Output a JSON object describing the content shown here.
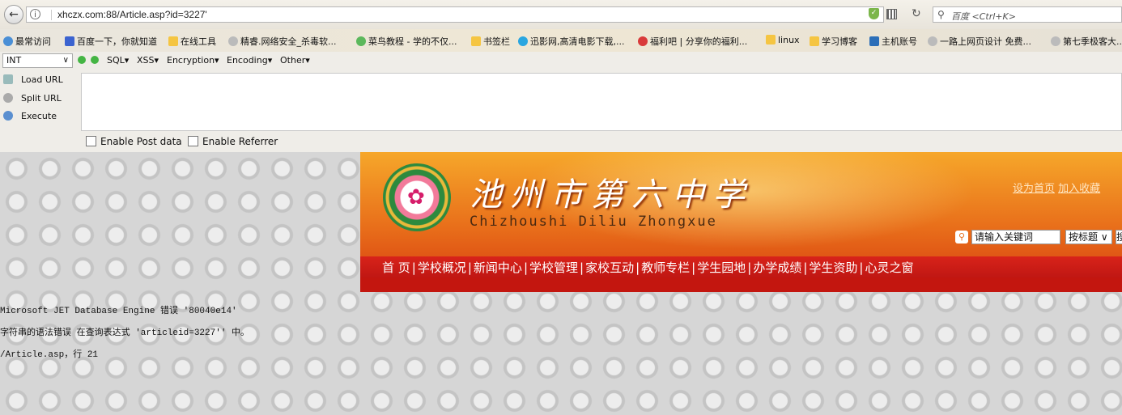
{
  "browser": {
    "url": "xhczx.com:88/Article.asp?id=3227'",
    "search_placeholder": "百度 <Ctrl+K>",
    "bookmarks": [
      "最常访问",
      "百度一下，你就知道",
      "在线工具",
      "精睿.网络安全_杀毒软...",
      "菜鸟教程 - 学的不仅...",
      "书签栏",
      "迅影网,高清电影下载,...",
      "福利吧 | 分享你的福利...",
      "linux",
      "学习博客",
      "主机账号",
      "一路上网页设计 免费...",
      "第七季极客大..."
    ]
  },
  "hackbar": {
    "mode": "INT",
    "menus": [
      "SQL▾",
      "XSS▾",
      "Encryption▾",
      "Encoding▾",
      "Other▾"
    ],
    "actions": [
      "Load URL",
      "Split URL",
      "Execute"
    ],
    "checkboxes": [
      "Enable Post data",
      "Enable Referrer"
    ]
  },
  "site": {
    "name": "池州市第六中学",
    "pinyin": "Chizhoushi Diliu Zhongxue",
    "top_links": [
      "设为首页",
      "加入收藏"
    ],
    "search_placeholder": "请输入关键词",
    "search_mode": "按标题",
    "search_button": "搜",
    "nav": [
      "首 页",
      "学校概况",
      "新闻中心",
      "学校管理",
      "家校互动",
      "教师专栏",
      "学生园地",
      "办学成绩",
      "学生资助",
      "心灵之窗"
    ]
  },
  "error": {
    "line1": "Microsoft JET Database Engine 错误 '80040e14'",
    "line2": "字符串的语法错误 在查询表达式 'articleid=3227'' 中。",
    "line3": "/Article.asp，行 21"
  }
}
